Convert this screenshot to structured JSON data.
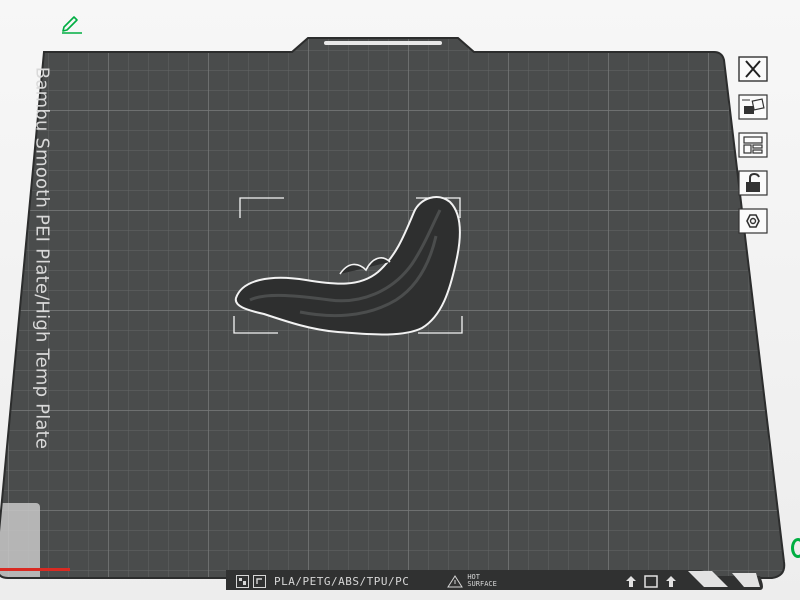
{
  "plate": {
    "label": "Bambu Smooth PEI Plate/High Temp Plate",
    "materials": "PLA/PETG/ABS/TPU/PC",
    "warning": [
      "HOT",
      "SURFACE"
    ]
  },
  "toolbar": {
    "items": [
      {
        "name": "remove-plate",
        "icon": "close-icon"
      },
      {
        "name": "auto-orient",
        "icon": "orient-icon"
      },
      {
        "name": "arrange",
        "icon": "arrange-icon"
      },
      {
        "name": "lock-plate",
        "icon": "unlock-icon"
      },
      {
        "name": "plate-settings",
        "icon": "settings-hex-icon"
      }
    ]
  },
  "colors": {
    "accent": "#00ae42",
    "plate": "#4b4d4d",
    "grid": "#6a6c6c",
    "axis_x": "#d92a22"
  }
}
